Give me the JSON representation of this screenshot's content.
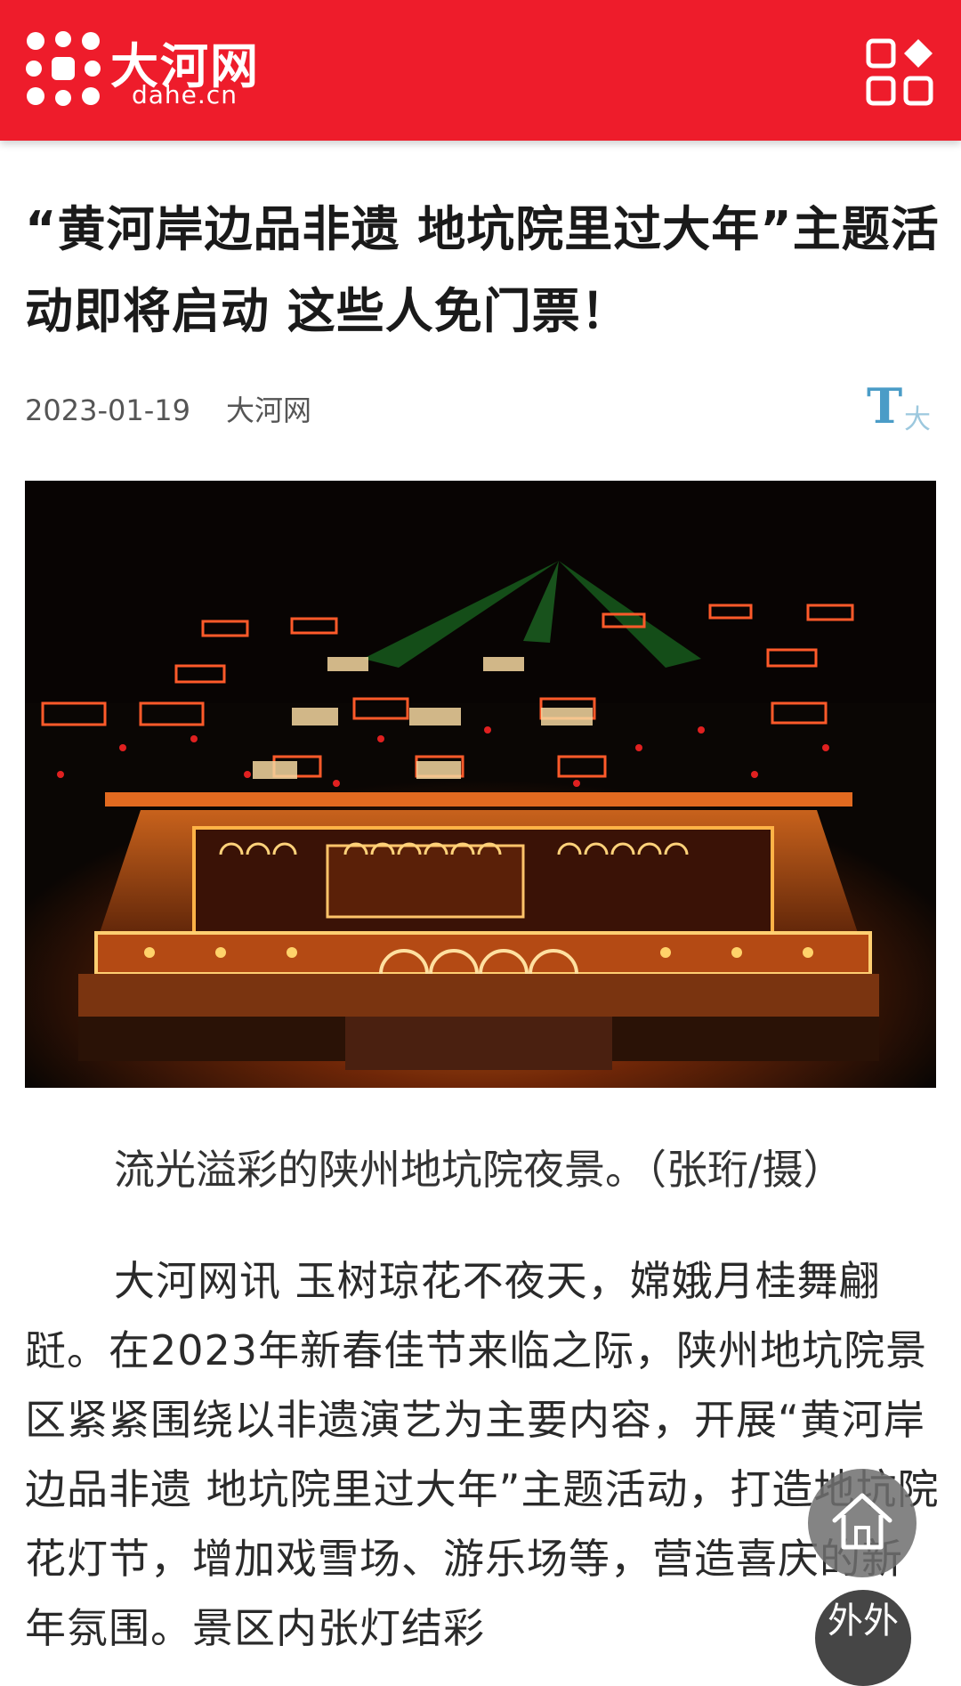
{
  "header": {
    "logo_cn": "大河网",
    "logo_en": "dahe.cn",
    "brand_color": "#ee1c2b",
    "menu_icon": "apps-grid-icon"
  },
  "article": {
    "title": "“黄河岸边品非遗 地坑院里过大年”主题活动即将启动 这些人免门票！",
    "date": "2023-01-19",
    "source": "大河网",
    "font_toggle": {
      "letter": "T",
      "label": "大"
    },
    "image_caption": "流光溢彩的陕州地坑院夜景。（张珩/摄）",
    "body": "大河网讯  玉树琼花不夜天，嫦娥月桂舞翩跹。在2023年新春佳节来临之际，陕州地坑院景区紧紧围绕以非遗演艺为主要内容，开展“黄河岸边品非遗 地坑院里过大年”主题活动，打造地坑院花灯节，增加戏雪场、游乐场等，营造喜庆的新年氛围。景区内张灯结彩"
  },
  "floating": {
    "home_icon": "home-icon",
    "share_label": "外外"
  }
}
